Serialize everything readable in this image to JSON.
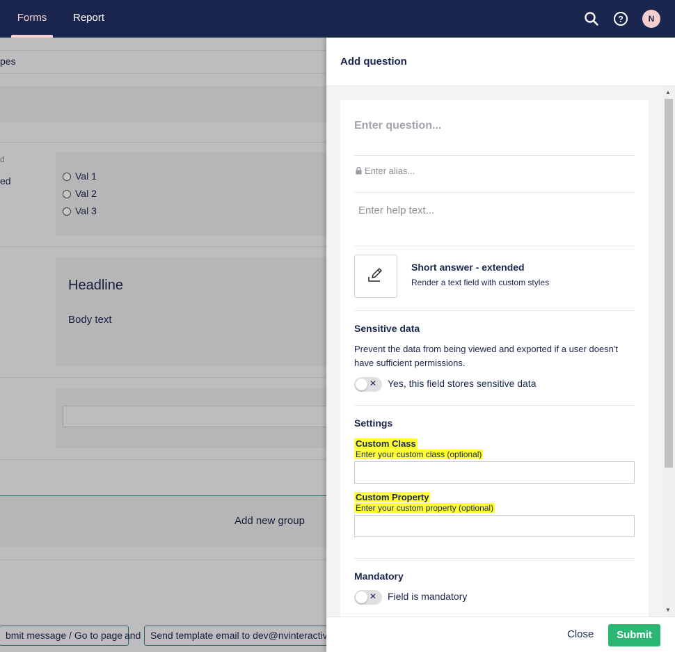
{
  "topbar": {
    "tabs": [
      {
        "label": "Forms"
      },
      {
        "label": "Report"
      }
    ],
    "avatar_initial": "N",
    "icons": [
      "search-icon",
      "help-icon"
    ]
  },
  "background": {
    "header_partial": "pes",
    "left_label_1": "d",
    "left_label_2": "ed",
    "radio_options": [
      "Val 1",
      "Val 2",
      "Val 3"
    ],
    "headline": "Headline",
    "body_text": "Body text",
    "add_group_label": "Add new group",
    "workflow": {
      "submit_chip": "bmit message / Go to page",
      "connector": "and",
      "email_chip": "Send template email to dev@nvinteractive"
    }
  },
  "panel": {
    "title": "Add question",
    "question_placeholder": "Enter question...",
    "alias_placeholder": "Enter alias...",
    "help_placeholder": "Enter help text...",
    "field_type": {
      "icon": "pencil-edit-icon",
      "name": "Short answer - extended",
      "description": "Render a text field with custom styles"
    },
    "sensitive": {
      "title": "Sensitive data",
      "description": "Prevent the data from being viewed and exported if a user doesn't have sufficient permissions.",
      "toggle_label": "Yes, this field stores sensitive data"
    },
    "settings": {
      "title": "Settings",
      "custom_class_label": "Custom Class",
      "custom_class_desc": "Enter your custom class (optional)",
      "custom_property_label": "Custom Property",
      "custom_property_desc": "Enter your custom property (optional)"
    },
    "mandatory": {
      "title": "Mandatory",
      "toggle_label": "Field is mandatory"
    },
    "footer": {
      "close_label": "Close",
      "submit_label": "Submit"
    }
  },
  "colors": {
    "navy": "#1b264f",
    "accent_pink": "#f5cfcf",
    "submit_green": "#2bb673",
    "highlight_yellow": "#ffff33"
  }
}
